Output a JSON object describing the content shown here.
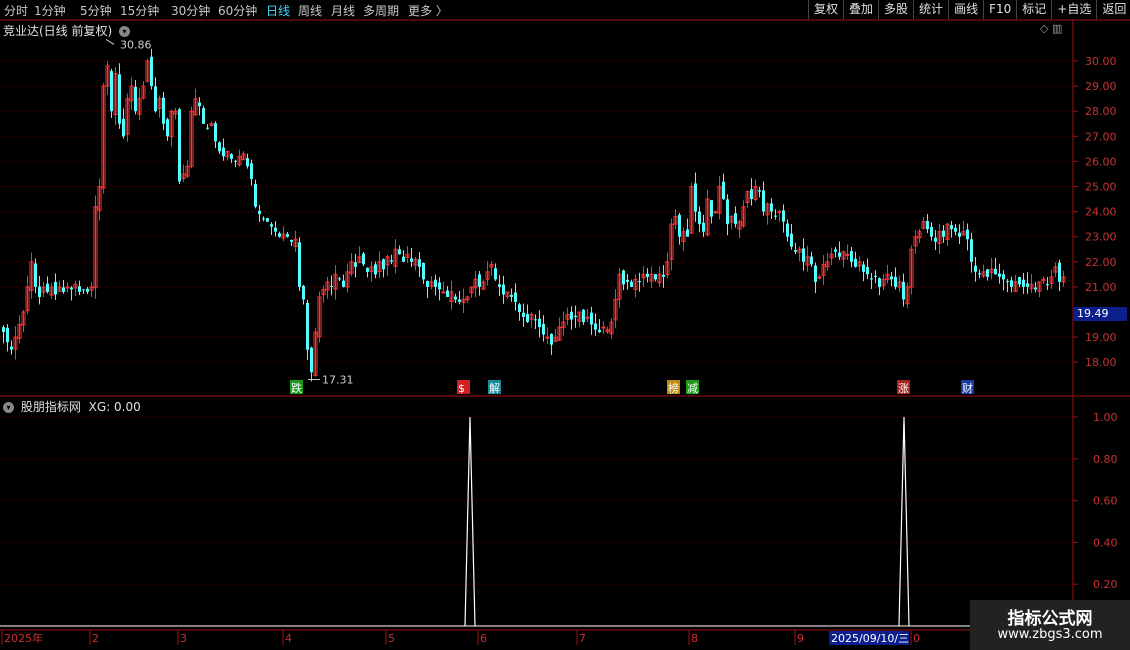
{
  "toolbar": {
    "periods": [
      "分时",
      "1分钟",
      "5分钟",
      "15分钟",
      "30分钟",
      "60分钟",
      "日线",
      "周线",
      "月线",
      "多周期",
      "更多 〉"
    ],
    "active_period": "日线",
    "buttons": [
      "复权",
      "叠加",
      "多股",
      "统计",
      "画线",
      "F10",
      "标记",
      "+自选",
      "返回"
    ]
  },
  "main_chart": {
    "title": "竞业达(日线 前复权)",
    "dropdown_icon": "chevron-down-icon",
    "high_label": "30.86",
    "low_label": "17.31",
    "current_price": "19.49",
    "y_ticks": [
      "30.00",
      "29.00",
      "28.00",
      "27.00",
      "26.00",
      "25.00",
      "24.00",
      "23.00",
      "22.00",
      "21.00",
      "19.00",
      "18.00"
    ],
    "markers": [
      {
        "text": "跌",
        "color": "#1a9a1a"
      },
      {
        "text": "$",
        "color": "#cc2222"
      },
      {
        "text": "解",
        "color": "#1a8a9a"
      },
      {
        "text": "榜",
        "color": "#c08a10"
      },
      {
        "text": "减",
        "color": "#1a9a1a"
      },
      {
        "text": "涨",
        "color": "#aa2222"
      },
      {
        "text": "财",
        "color": "#1a3aaa"
      }
    ],
    "up_color": "#ff3232",
    "down_color": "#54ffff"
  },
  "indicator": {
    "title": "股朋指标网",
    "value_label": "XG: 0.00",
    "y_ticks": [
      "1.00",
      "0.80",
      "0.60",
      "0.40",
      "0.20"
    ]
  },
  "x_axis": {
    "labels": [
      "2025年",
      "2",
      "3",
      "4",
      "5",
      "6",
      "7",
      "8",
      "9",
      "0"
    ],
    "cursor_date": "2025/09/10/三"
  },
  "watermark": {
    "line1": "指标公式网",
    "line2": "www.zbgs3.com"
  },
  "chart_data": {
    "type": "candlestick",
    "security": "竞业达",
    "period": "日线",
    "adjust": "前复权",
    "price_range": [
      17.0,
      31.0
    ],
    "max": 30.86,
    "min": 17.31,
    "last": 19.49,
    "close_path": [
      [
        0,
        19.2
      ],
      [
        4,
        18.8
      ],
      [
        8,
        18.5
      ],
      [
        12,
        19.0
      ],
      [
        16,
        19.5
      ],
      [
        20,
        20.0
      ],
      [
        24,
        21.0
      ],
      [
        28,
        22.0
      ],
      [
        32,
        21.0
      ],
      [
        36,
        20.6
      ],
      [
        40,
        21.0
      ],
      [
        44,
        20.8
      ],
      [
        48,
        21.0
      ],
      [
        52,
        20.7
      ],
      [
        56,
        21.0
      ],
      [
        60,
        20.8
      ],
      [
        64,
        21.0
      ],
      [
        68,
        20.9
      ],
      [
        72,
        21.1
      ],
      [
        76,
        20.8
      ],
      [
        80,
        20.9
      ],
      [
        84,
        20.8
      ],
      [
        88,
        21.0
      ],
      [
        92,
        24.2
      ],
      [
        96,
        25.0
      ],
      [
        100,
        29.0
      ],
      [
        104,
        29.8
      ],
      [
        108,
        28.0
      ],
      [
        112,
        29.5
      ],
      [
        116,
        27.5
      ],
      [
        120,
        27.0
      ],
      [
        124,
        28.5
      ],
      [
        128,
        29.0
      ],
      [
        132,
        28.0
      ],
      [
        136,
        28.5
      ],
      [
        140,
        29.0
      ],
      [
        144,
        30.0
      ],
      [
        148,
        29.0
      ],
      [
        152,
        28.0
      ],
      [
        156,
        28.5
      ],
      [
        160,
        27.5
      ],
      [
        164,
        27.0
      ],
      [
        168,
        28.0
      ],
      [
        172,
        28.0
      ],
      [
        176,
        25.2
      ],
      [
        180,
        25.5
      ],
      [
        184,
        25.8
      ],
      [
        188,
        28.0
      ],
      [
        192,
        28.5
      ],
      [
        196,
        28.2
      ],
      [
        200,
        27.5
      ],
      [
        204,
        27.3
      ],
      [
        208,
        27.5
      ],
      [
        212,
        26.8
      ],
      [
        216,
        26.4
      ],
      [
        220,
        26.2
      ],
      [
        224,
        26.4
      ],
      [
        228,
        26.1
      ],
      [
        232,
        26.0
      ],
      [
        236,
        26.2
      ],
      [
        240,
        26.3
      ],
      [
        244,
        25.8
      ],
      [
        248,
        25.3
      ],
      [
        252,
        24.2
      ],
      [
        256,
        23.9
      ],
      [
        260,
        23.7
      ],
      [
        264,
        23.6
      ],
      [
        268,
        23.4
      ],
      [
        272,
        23.2
      ],
      [
        276,
        23.0
      ],
      [
        280,
        23.1
      ],
      [
        284,
        23.0
      ],
      [
        288,
        22.8
      ],
      [
        292,
        22.9
      ],
      [
        296,
        21.0
      ],
      [
        300,
        20.5
      ],
      [
        304,
        18.5
      ],
      [
        308,
        17.6
      ],
      [
        312,
        19.2
      ],
      [
        316,
        20.6
      ],
      [
        320,
        20.9
      ],
      [
        324,
        21.2
      ],
      [
        328,
        21.0
      ],
      [
        332,
        21.5
      ],
      [
        336,
        21.3
      ],
      [
        340,
        21.0
      ],
      [
        344,
        21.6
      ],
      [
        348,
        22.0
      ],
      [
        352,
        21.8
      ],
      [
        356,
        22.2
      ],
      [
        360,
        21.9
      ],
      [
        364,
        21.6
      ],
      [
        368,
        21.8
      ],
      [
        372,
        21.5
      ],
      [
        376,
        22.0
      ],
      [
        380,
        21.7
      ],
      [
        384,
        22.2
      ],
      [
        388,
        22.0
      ],
      [
        392,
        22.5
      ],
      [
        396,
        22.3
      ],
      [
        400,
        22.0
      ],
      [
        404,
        22.3
      ],
      [
        408,
        22.0
      ],
      [
        412,
        22.1
      ],
      [
        416,
        21.8
      ],
      [
        420,
        21.3
      ],
      [
        424,
        21.0
      ],
      [
        428,
        21.2
      ],
      [
        432,
        21.0
      ],
      [
        436,
        20.9
      ],
      [
        440,
        20.8
      ],
      [
        444,
        20.6
      ],
      [
        448,
        20.8
      ],
      [
        452,
        20.5
      ],
      [
        456,
        20.4
      ],
      [
        460,
        20.5
      ],
      [
        464,
        20.6
      ],
      [
        468,
        21.0
      ],
      [
        472,
        21.3
      ],
      [
        476,
        21.0
      ],
      [
        480,
        21.2
      ],
      [
        484,
        21.6
      ],
      [
        488,
        21.9
      ],
      [
        492,
        21.3
      ],
      [
        496,
        21.0
      ],
      [
        500,
        20.7
      ],
      [
        504,
        20.8
      ],
      [
        508,
        20.6
      ],
      [
        512,
        20.4
      ],
      [
        516,
        20.0
      ],
      [
        520,
        19.8
      ],
      [
        524,
        19.6
      ],
      [
        528,
        19.9
      ],
      [
        532,
        19.7
      ],
      [
        536,
        19.4
      ],
      [
        540,
        19.1
      ],
      [
        544,
        19.0
      ],
      [
        548,
        18.7
      ],
      [
        552,
        19.0
      ],
      [
        556,
        19.4
      ],
      [
        560,
        19.6
      ],
      [
        564,
        19.9
      ],
      [
        568,
        19.7
      ],
      [
        572,
        19.8
      ],
      [
        576,
        20.0
      ],
      [
        580,
        19.6
      ],
      [
        584,
        19.8
      ],
      [
        588,
        19.5
      ],
      [
        592,
        19.3
      ],
      [
        596,
        19.2
      ],
      [
        600,
        19.4
      ],
      [
        604,
        19.3
      ],
      [
        608,
        19.6
      ],
      [
        612,
        20.5
      ],
      [
        616,
        21.5
      ],
      [
        620,
        21.1
      ],
      [
        624,
        21.2
      ],
      [
        628,
        21.0
      ],
      [
        632,
        21.3
      ],
      [
        636,
        21.2
      ],
      [
        640,
        21.5
      ],
      [
        644,
        21.4
      ],
      [
        648,
        21.5
      ],
      [
        652,
        21.3
      ],
      [
        656,
        21.5
      ],
      [
        660,
        21.4
      ],
      [
        664,
        22.0
      ],
      [
        668,
        23.5
      ],
      [
        672,
        23.8
      ],
      [
        676,
        23.0
      ],
      [
        680,
        23.2
      ],
      [
        684,
        23.0
      ],
      [
        688,
        25.0
      ],
      [
        692,
        24.0
      ],
      [
        696,
        23.5
      ],
      [
        700,
        23.2
      ],
      [
        704,
        24.5
      ],
      [
        708,
        23.8
      ],
      [
        712,
        24.0
      ],
      [
        716,
        25.0
      ],
      [
        720,
        24.5
      ],
      [
        724,
        23.5
      ],
      [
        728,
        23.8
      ],
      [
        732,
        23.5
      ],
      [
        736,
        23.6
      ],
      [
        740,
        24.2
      ],
      [
        744,
        24.8
      ],
      [
        748,
        24.5
      ],
      [
        752,
        25.0
      ],
      [
        756,
        24.8
      ],
      [
        760,
        24.0
      ],
      [
        764,
        24.3
      ],
      [
        768,
        24.0
      ],
      [
        772,
        23.8
      ],
      [
        776,
        24.0
      ],
      [
        780,
        23.6
      ],
      [
        784,
        23.0
      ],
      [
        788,
        22.6
      ],
      [
        792,
        22.4
      ],
      [
        796,
        22.5
      ],
      [
        800,
        22.0
      ],
      [
        804,
        22.2
      ],
      [
        808,
        21.9
      ],
      [
        812,
        21.2
      ],
      [
        816,
        21.4
      ],
      [
        820,
        21.9
      ],
      [
        824,
        22.0
      ],
      [
        828,
        22.3
      ],
      [
        832,
        22.4
      ],
      [
        836,
        22.2
      ],
      [
        840,
        22.4
      ],
      [
        844,
        22.3
      ],
      [
        848,
        22.0
      ],
      [
        852,
        21.8
      ],
      [
        856,
        22.0
      ],
      [
        860,
        21.6
      ],
      [
        864,
        21.5
      ],
      [
        868,
        21.3
      ],
      [
        872,
        21.4
      ],
      [
        876,
        21.0
      ],
      [
        880,
        21.3
      ],
      [
        884,
        21.5
      ],
      [
        888,
        21.3
      ],
      [
        892,
        21.0
      ],
      [
        896,
        21.2
      ],
      [
        900,
        20.5
      ],
      [
        904,
        21.0
      ],
      [
        908,
        22.5
      ],
      [
        912,
        23.0
      ],
      [
        916,
        23.2
      ],
      [
        920,
        23.6
      ],
      [
        924,
        23.3
      ],
      [
        928,
        23.0
      ],
      [
        932,
        22.8
      ],
      [
        936,
        23.2
      ],
      [
        940,
        23.0
      ],
      [
        944,
        23.5
      ],
      [
        948,
        23.3
      ],
      [
        952,
        23.2
      ],
      [
        956,
        23.0
      ],
      [
        960,
        23.2
      ],
      [
        964,
        22.9
      ],
      [
        968,
        22.0
      ],
      [
        972,
        21.6
      ],
      [
        976,
        21.5
      ],
      [
        980,
        21.6
      ],
      [
        984,
        21.4
      ],
      [
        988,
        21.7
      ],
      [
        992,
        21.5
      ],
      [
        996,
        21.4
      ],
      [
        1000,
        21.3
      ],
      [
        1004,
        21.2
      ],
      [
        1008,
        21.0
      ],
      [
        1012,
        21.2
      ],
      [
        1016,
        21.1
      ],
      [
        1020,
        21.0
      ],
      [
        1024,
        21.0
      ],
      [
        1028,
        21.1
      ],
      [
        1032,
        20.9
      ],
      [
        1036,
        21.2
      ],
      [
        1040,
        21.3
      ],
      [
        1044,
        21.1
      ],
      [
        1048,
        21.4
      ],
      [
        1052,
        21.8
      ],
      [
        1056,
        21.2
      ],
      [
        1060,
        21.4
      ]
    ],
    "indicator_series": {
      "name": "XG",
      "range": [
        0,
        1.05
      ],
      "spikes": [
        470,
        904
      ]
    }
  }
}
